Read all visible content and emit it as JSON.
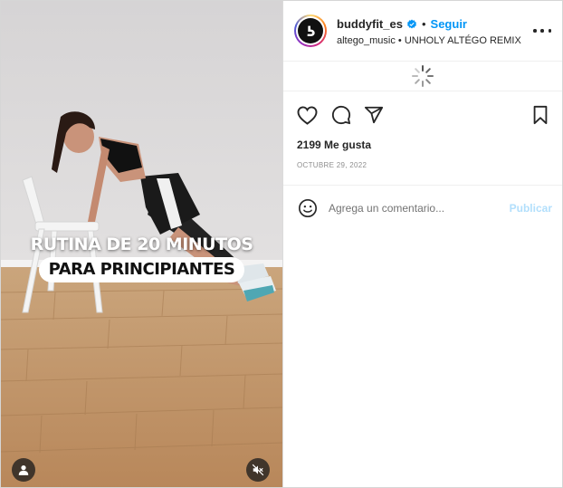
{
  "post": {
    "username": "buddyfit_es",
    "follow_label": "Seguir",
    "separator": "•",
    "audio_artist": "altego_music",
    "audio_track": "UNHOLY ALTÉGO REMIX",
    "likes_text": "2199 Me gusta",
    "date_text": "OCTUBRE 29, 2022"
  },
  "video": {
    "caption_line1": "RUTINA DE 20 MINUTOS",
    "caption_line2": "PARA PRINCIPIANTES"
  },
  "comment_box": {
    "placeholder": "Agrega un comentario...",
    "publish_label": "Publicar"
  },
  "icons": {
    "verified": "verified-badge-icon",
    "more": "more-options-icon",
    "loading": "loading-spinner-icon",
    "like": "heart-icon",
    "comment": "comment-bubble-icon",
    "share": "paper-plane-icon",
    "save": "bookmark-icon",
    "emoji": "emoji-icon",
    "tagged_user": "user-icon",
    "mute": "speaker-muted-icon"
  },
  "colors": {
    "link_blue": "#0095f6",
    "publish_disabled": "#b2dffc",
    "text_primary": "#262626",
    "text_secondary": "#8e8e8e"
  }
}
